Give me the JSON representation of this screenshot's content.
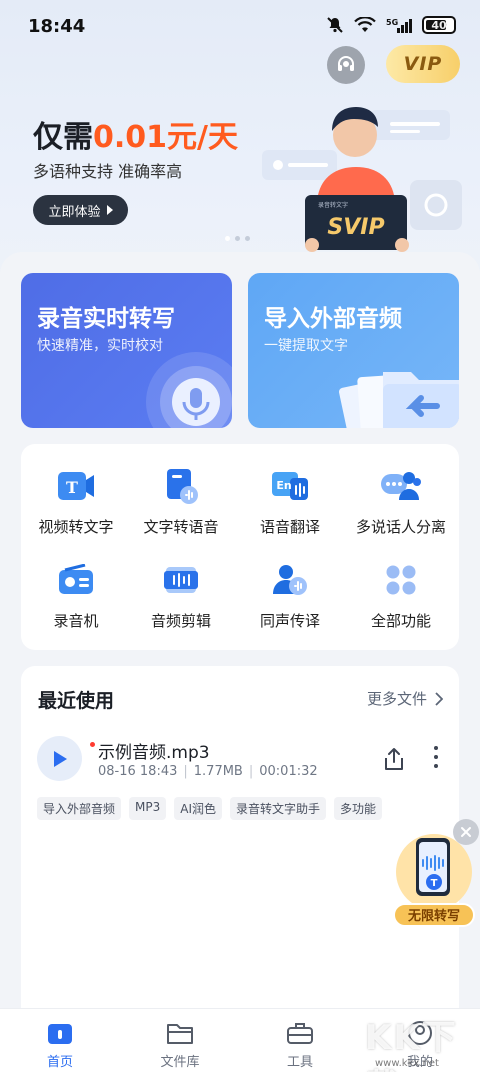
{
  "status_bar": {
    "time": "18:44",
    "battery": "40"
  },
  "header": {
    "vip_label": "VIP"
  },
  "promo": {
    "title_prefix": "仅需",
    "title_accent": "0.01元/天",
    "subtitle": "多语种支持 准确率高",
    "cta": "立即体验",
    "badge": "SVIP",
    "badge_caption": "录音转文字"
  },
  "feature_cards": [
    {
      "title": "录音实时转写",
      "subtitle": "快速精准，实时校对"
    },
    {
      "title": "导入外部音频",
      "subtitle": "一键提取文字"
    }
  ],
  "tools": [
    {
      "label": "视频转文字",
      "icon": "video-to-text-icon",
      "glyph": "T"
    },
    {
      "label": "文字转语音",
      "icon": "text-to-speech-icon"
    },
    {
      "label": "语音翻译",
      "icon": "voice-translate-icon",
      "glyph": "En"
    },
    {
      "label": "多说话人分离",
      "icon": "multi-speaker-icon"
    },
    {
      "label": "录音机",
      "icon": "recorder-icon"
    },
    {
      "label": "音频剪辑",
      "icon": "audio-edit-icon"
    },
    {
      "label": "同声传译",
      "icon": "simultaneous-interpret-icon"
    },
    {
      "label": "全部功能",
      "icon": "all-features-icon"
    }
  ],
  "recent": {
    "title": "最近使用",
    "more": "更多文件",
    "file": {
      "name": "示例音频.mp3",
      "date": "08-16 18:43",
      "size": "1.77MB",
      "duration": "00:01:32",
      "tags": [
        "导入外部音频",
        "MP3",
        "AI润色",
        "录音转文字助手",
        "多功能"
      ]
    }
  },
  "float_promo": {
    "label": "无限转写",
    "glyph": "T"
  },
  "tabs": [
    {
      "label": "首页",
      "icon": "home-icon",
      "active": true
    },
    {
      "label": "文件库",
      "icon": "folder-icon"
    },
    {
      "label": "工具",
      "icon": "toolbox-icon"
    },
    {
      "label": "我的",
      "icon": "profile-icon"
    }
  ],
  "watermark": {
    "text": "KK下载",
    "url": "www.kkx.net"
  },
  "colors": {
    "accent": "#2b6df0",
    "promo_accent": "#ff5b1f",
    "card_left": "#5b7df2",
    "card_right": "#76b6f8"
  }
}
